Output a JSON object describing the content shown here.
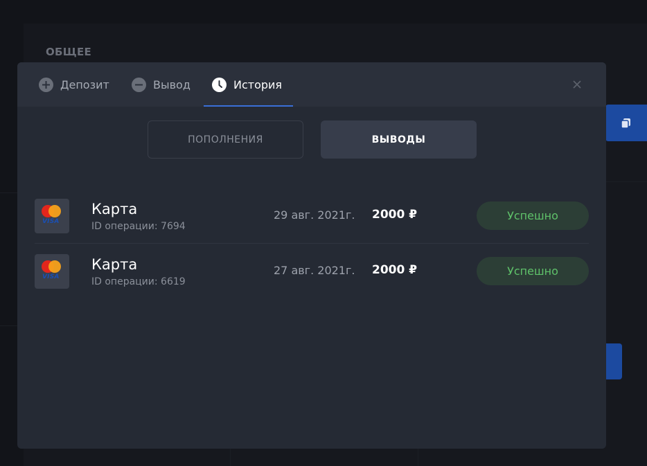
{
  "background": {
    "section_title": "ОБЩЕЕ",
    "copy_icon": "copy-icon"
  },
  "modal": {
    "tabs": [
      {
        "label": "Депозит",
        "icon": "plus-circle-icon",
        "active": false
      },
      {
        "label": "Вывод",
        "icon": "minus-circle-icon",
        "active": false
      },
      {
        "label": "История",
        "icon": "clock-icon",
        "active": true
      }
    ],
    "close_icon": "close-icon",
    "segments": [
      {
        "label": "ПОПОЛНЕНИЯ",
        "active": false
      },
      {
        "label": "ВЫВОДЫ",
        "active": true
      }
    ],
    "transactions": [
      {
        "method": "Карта",
        "operation_id": "ID операции: 7694",
        "date": "29 авг. 2021г.",
        "amount": "2000 ₽",
        "status": "Успешно",
        "logo_icon": "mastercard-visa-icon"
      },
      {
        "method": "Карта",
        "operation_id": "ID операции: 6619",
        "date": "27 авг. 2021г.",
        "amount": "2000 ₽",
        "status": "Успешно",
        "logo_icon": "mastercard-visa-icon"
      }
    ]
  },
  "colors": {
    "accent": "#3a6fd8",
    "success_text": "#5fc26a",
    "success_bg": "#2c3e36",
    "modal_bg": "#252a34"
  }
}
